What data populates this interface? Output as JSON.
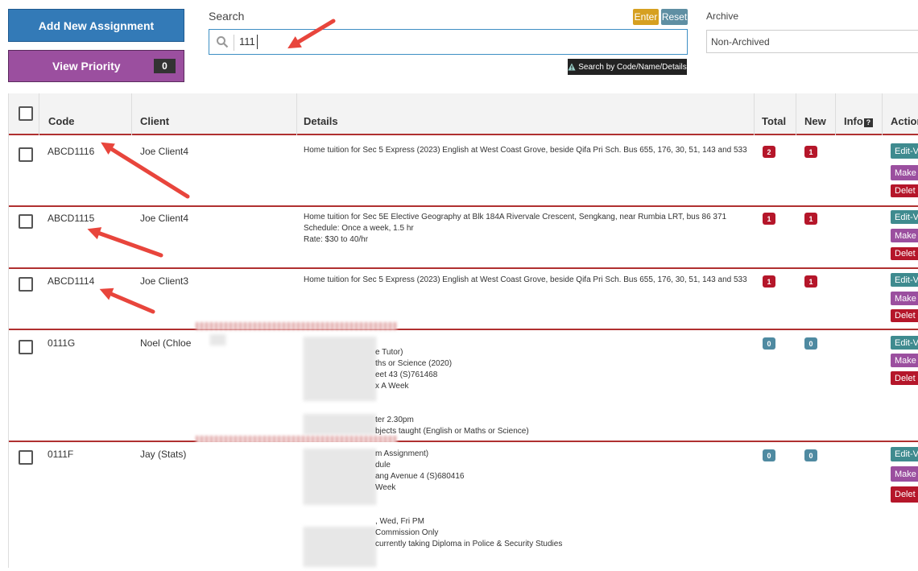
{
  "toolbar": {
    "add_label": "Add New Assignment",
    "priority_label": "View Priority",
    "priority_count": "0"
  },
  "search": {
    "label": "Search",
    "value": "111",
    "enter_label": "Enter",
    "reset_label": "Reset",
    "tooltip": "Search by Code/Name/Details"
  },
  "archive": {
    "label": "Archive",
    "selected": "Non-Archived"
  },
  "table": {
    "headers": {
      "code": "Code",
      "client": "Client",
      "details": "Details",
      "total": "Total",
      "new": "New",
      "info": "Info",
      "action": "Action"
    },
    "rows": [
      {
        "code": "ABCD1116",
        "client": "Joe Client4",
        "details": "Home tuition for Sec 5 Express (2023) English at West Coast Grove, beside Qifa Pri Sch. Bus 655, 176, 30, 51, 143 and 533",
        "total": "2",
        "new": "1"
      },
      {
        "code": "ABCD1115",
        "client": "Joe Client4",
        "details": "Home tuition for Sec 5E Elective Geography at Blk 184A Rivervale Crescent, Sengkang, near Rumbia LRT, bus 86 371\nSchedule: Once a week, 1.5 hr\nRate: $30 to 40/hr",
        "total": "1",
        "new": "1"
      },
      {
        "code": "ABCD1114",
        "client": "Joe Client3",
        "details": "Home tuition for Sec 5 Express (2023) English at West Coast Grove, beside Qifa Pri Sch. Bus 655, 176, 30, 51, 143 and 533",
        "total": "1",
        "new": "1"
      },
      {
        "code": "0111G",
        "client": "Noel (Chloe",
        "details": "e Tutor)\nths or Science (2020)\neet 43 (S)761468\nx A Week\n\n\nter 2.30pm\nbjects taught (English or Maths or Science)",
        "total": "0",
        "new": "0"
      },
      {
        "code": "0111F",
        "client": "Jay (Stats)",
        "details": "m Assignment)\ndule\nang Avenue 4 (S)680416\nWeek\n\n\n, Wed, Fri PM\nCommission Only\ncurrently taking Diploma in Police & Security Studies",
        "total": "0",
        "new": "0"
      }
    ],
    "actions": {
      "edit": "Edit-V",
      "make": "Make",
      "delete": "Delet"
    }
  },
  "colors": {
    "primary": "#337ab7",
    "purple": "#9b4f9f",
    "danger": "#b5162a",
    "teal": "#4f8aa1",
    "annotation": "#e8453c"
  }
}
